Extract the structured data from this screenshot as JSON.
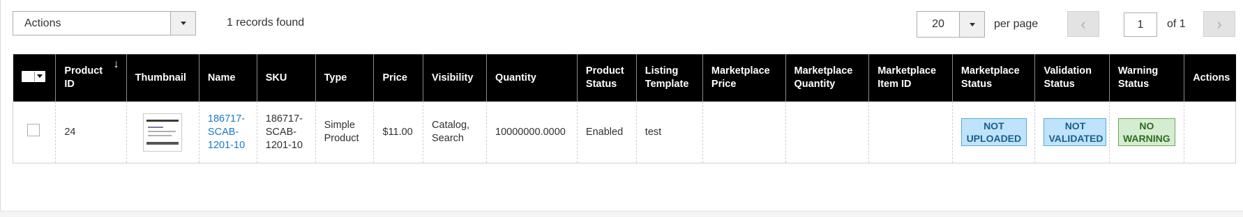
{
  "toolbar": {
    "actions_label": "Actions",
    "records_found": "1 records found",
    "per_page_value": "20",
    "per_page_label": "per page",
    "prev_icon": "‹",
    "next_icon": "›",
    "current_page": "1",
    "of_pages": "of 1"
  },
  "grid": {
    "columns": [
      "Product ID",
      "Thumbnail",
      "Name",
      "SKU",
      "Type",
      "Price",
      "Visibility",
      "Quantity",
      "Product Status",
      "Listing Template",
      "Marketplace Price",
      "Marketplace Quantity",
      "Marketplace Item ID",
      "Marketplace Status",
      "Validation Status",
      "Warning Status",
      "Actions"
    ],
    "sort_indicator": "↓",
    "rows": [
      {
        "product_id": "24",
        "name": "186717-SCAB-1201-10",
        "sku": "186717-SCAB-1201-10",
        "type": "Simple Product",
        "price": "$11.00",
        "visibility": "Catalog, Search",
        "quantity": "10000000.0000",
        "product_status": "Enabled",
        "listing_template": "test",
        "marketplace_price": "",
        "marketplace_quantity": "",
        "marketplace_item_id": "",
        "marketplace_status": "NOT UPLOADED",
        "validation_status": "NOT VALIDATED",
        "warning_status": "NO WARNING",
        "actions": ""
      }
    ]
  },
  "colors": {
    "header_bg": "#000000",
    "link": "#1979c3",
    "badge_blue_bg": "#bfe3fa",
    "badge_green_bg": "#d6ecd2"
  }
}
